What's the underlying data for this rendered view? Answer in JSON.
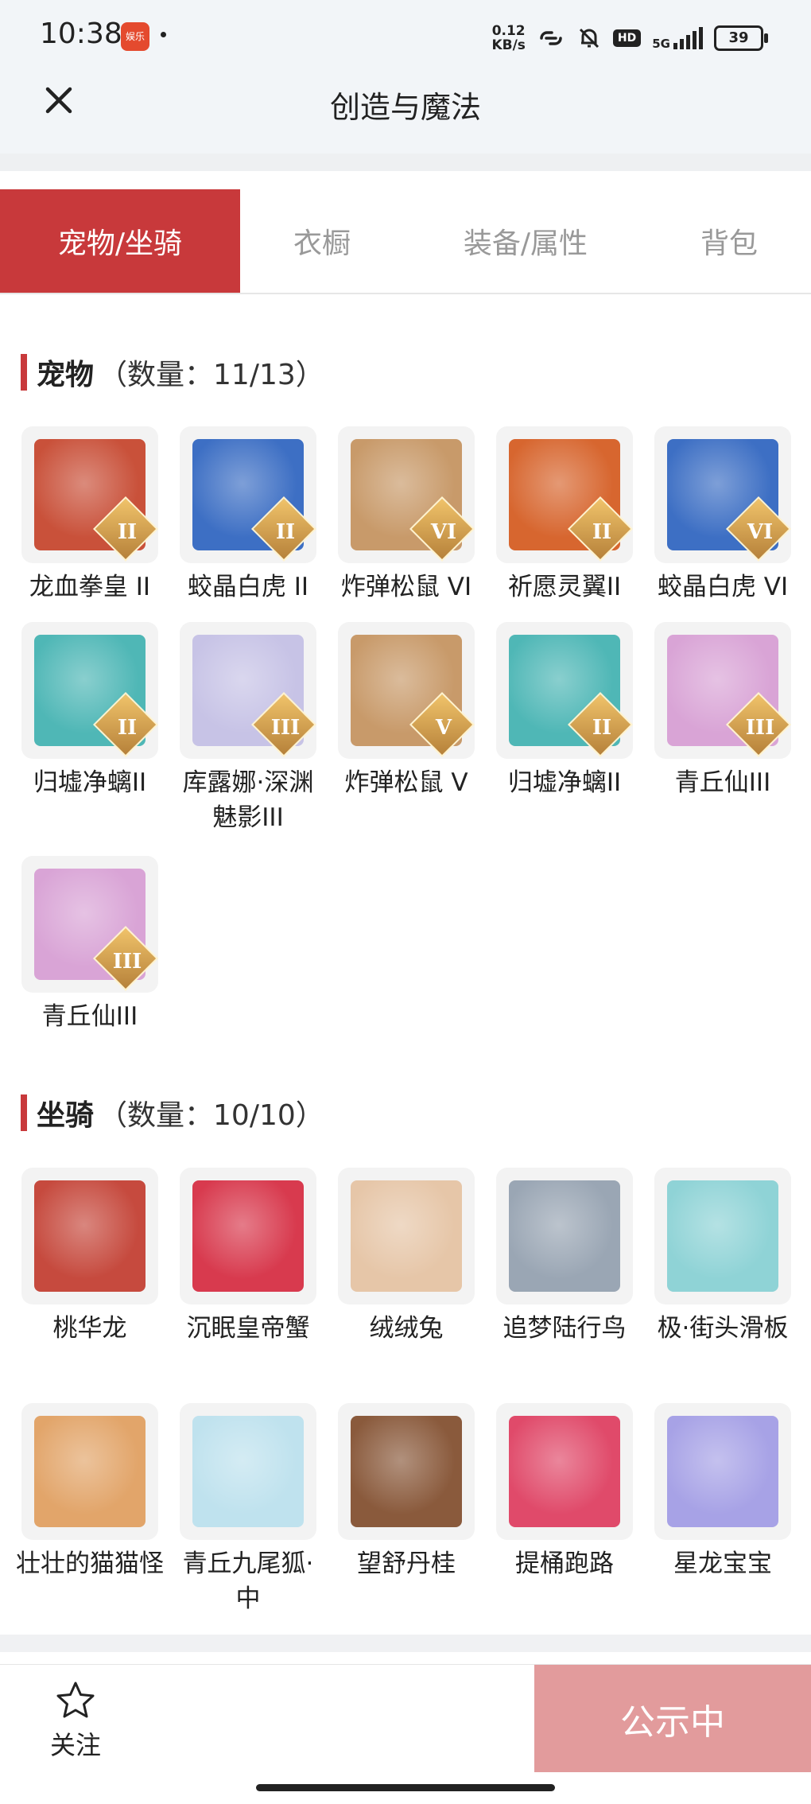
{
  "status_bar": {
    "time": "10:38",
    "app_badge": "娱乐",
    "net_speed_value": "0.12",
    "net_speed_unit": "KB/s",
    "hd_label": "HD",
    "network": "5G",
    "battery": "39"
  },
  "header": {
    "title": "创造与魔法"
  },
  "tabs": [
    {
      "label": "宠物/坐骑",
      "active": true
    },
    {
      "label": "衣橱",
      "active": false
    },
    {
      "label": "装备/属性",
      "active": false
    },
    {
      "label": "背包",
      "active": false
    }
  ],
  "pets": {
    "title": "宠物",
    "count": "（数量：11/13）",
    "items": [
      {
        "name": "龙血拳皇 II",
        "rank": "II",
        "color": "#c9513a",
        "icon": "dragon-fist-icon"
      },
      {
        "name": "蛟晶白虎 II",
        "rank": "II",
        "color": "#3d6fc4",
        "icon": "white-tiger-icon"
      },
      {
        "name": "炸弹松鼠 VI",
        "rank": "VI",
        "color": "#c89a6a",
        "icon": "squirrel-icon"
      },
      {
        "name": "祈愿灵翼II",
        "rank": "II",
        "color": "#d7662f",
        "icon": "wing-bird-icon"
      },
      {
        "name": "蛟晶白虎 VI",
        "rank": "VI",
        "color": "#3d6fc4",
        "icon": "white-tiger-icon"
      },
      {
        "name": "归墟净螭II",
        "rank": "II",
        "color": "#4fb7b6",
        "icon": "sea-dragon-icon"
      },
      {
        "name": "库露娜·深渊魅影III",
        "rank": "III",
        "color": "#c7c3e6",
        "icon": "fairy-icon"
      },
      {
        "name": "炸弹松鼠 V",
        "rank": "V",
        "color": "#c89a6a",
        "icon": "squirrel-icon"
      },
      {
        "name": "归墟净螭II",
        "rank": "II",
        "color": "#4fb7b6",
        "icon": "sea-dragon-icon"
      },
      {
        "name": "青丘仙III",
        "rank": "III",
        "color": "#d9a4d6",
        "icon": "fox-fairy-icon"
      },
      {
        "name": "青丘仙III",
        "rank": "III",
        "color": "#d9a4d6",
        "icon": "fox-fairy-icon"
      }
    ]
  },
  "mounts": {
    "title": "坐骑",
    "count": "（数量：10/10）",
    "items": [
      {
        "name": "桃华龙",
        "color": "#c64a3e",
        "icon": "peach-dragon-icon"
      },
      {
        "name": "沉眠皇帝蟹",
        "color": "#d83a4e",
        "icon": "crab-icon"
      },
      {
        "name": "绒绒兔",
        "color": "#e6c6a8",
        "icon": "rabbit-icon"
      },
      {
        "name": "追梦陆行鸟",
        "color": "#9aa6b4",
        "icon": "bird-icon"
      },
      {
        "name": "极·街头滑板",
        "color": "#8fd3d6",
        "icon": "skateboard-icon"
      },
      {
        "name": "壮壮的猫猫怪",
        "color": "#e2a56a",
        "icon": "cat-icon"
      },
      {
        "name": "青丘九尾狐·中",
        "color": "#bfe2ee",
        "icon": "nine-tail-fox-icon"
      },
      {
        "name": "望舒丹桂",
        "color": "#8a5a3c",
        "icon": "swing-icon"
      },
      {
        "name": "提桶跑路",
        "color": "#e04a6a",
        "icon": "bucket-icon"
      },
      {
        "name": "星龙宝宝",
        "color": "#a7a2e6",
        "icon": "star-dragon-icon"
      }
    ]
  },
  "bottom_bar": {
    "follow_label": "关注",
    "publish_label": "公示中"
  }
}
